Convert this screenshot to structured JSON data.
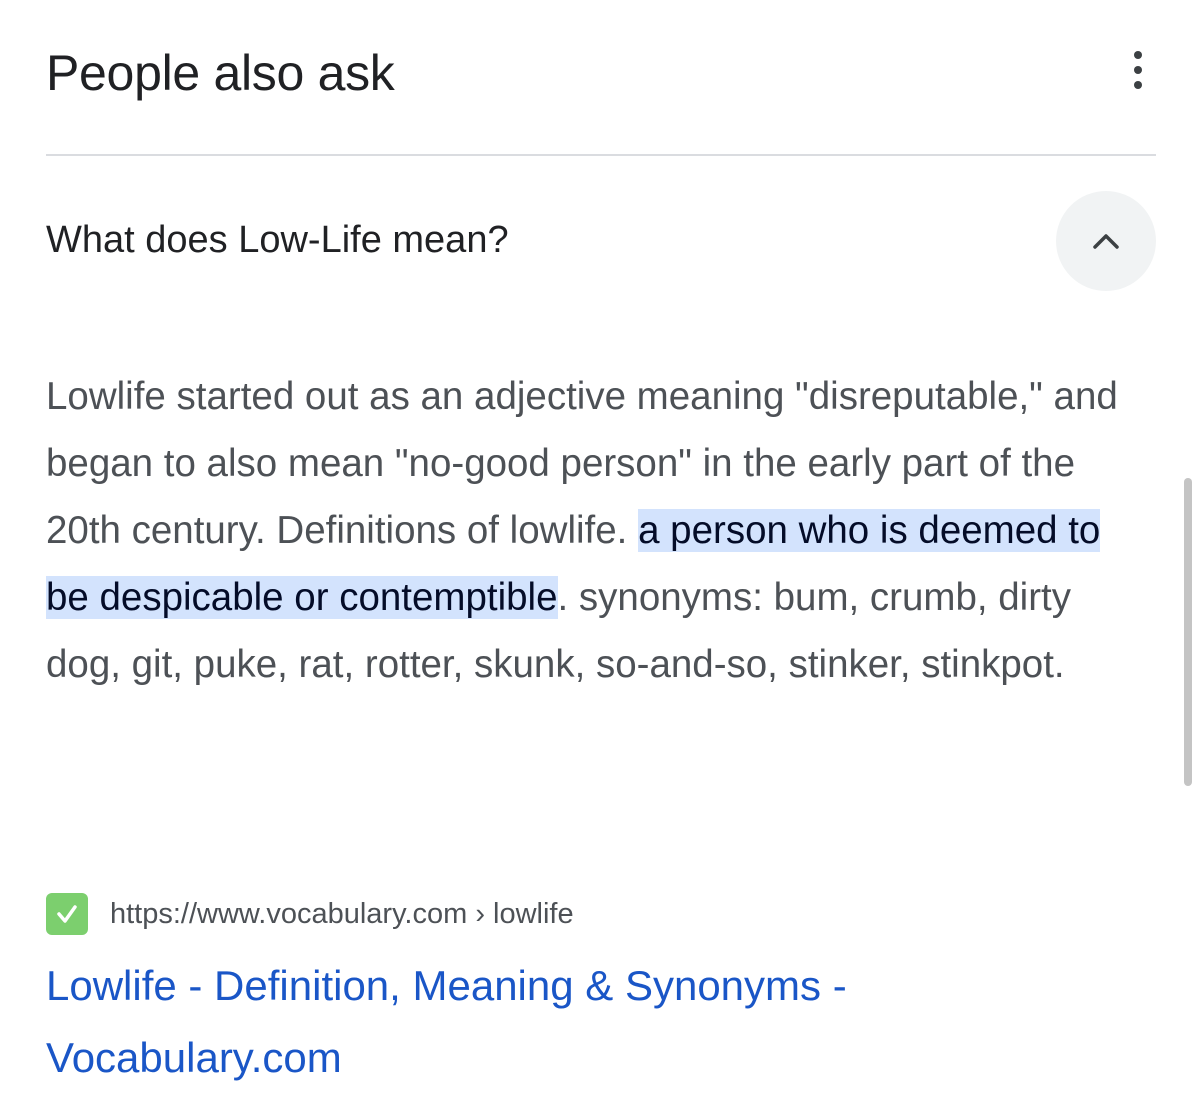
{
  "header": {
    "title": "People also ask"
  },
  "question": {
    "text": "What does Low-Life mean?"
  },
  "answer": {
    "text_before": "Lowlife started out as an adjective meaning \"disreputable,\" and began to also mean \"no-good person\" in the early part of the 20th century. Definitions of lowlife. ",
    "highlight": "a person who is deemed to be despicable or contemptible",
    "text_after": ". synonyms: bum, crumb, dirty dog, git, puke, rat, rotter, skunk, so-and-so, stinker, stinkpot."
  },
  "source": {
    "url": "https://www.vocabulary.com › lowlife",
    "favicon_icon": "checkmark-icon",
    "favicon_color": "#7ccf6e"
  },
  "result": {
    "title": "Lowlife - Definition, Meaning & Synonyms - Vocabulary.com"
  },
  "icons": {
    "more": "more-vert-icon",
    "collapse": "chevron-up-icon"
  },
  "colors": {
    "link": "#1a56c7",
    "highlight_bg": "#d3e3fd",
    "divider": "#dadce0"
  }
}
